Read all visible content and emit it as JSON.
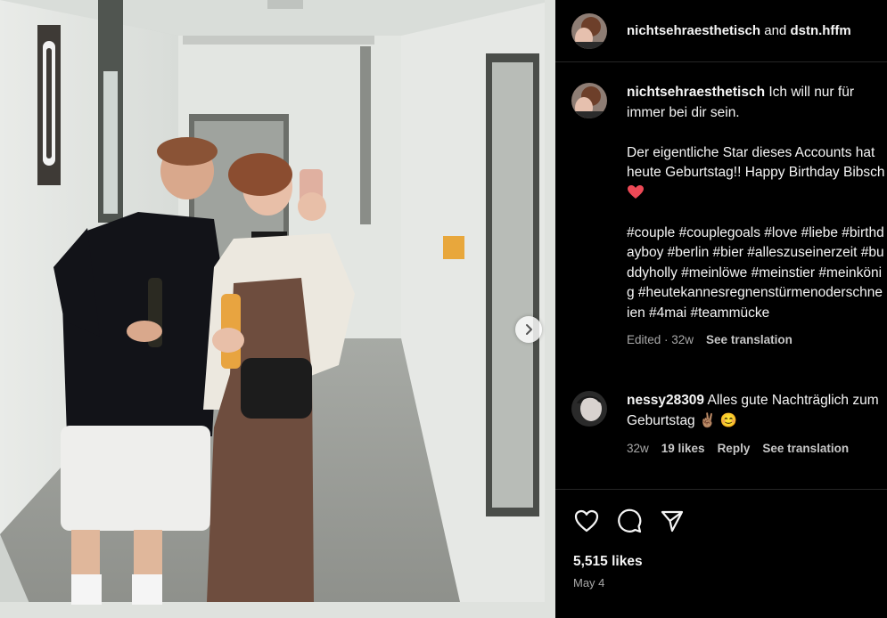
{
  "post": {
    "header": {
      "author": "nichtsehraesthetisch",
      "conjunction": "and",
      "collaborator": "dstn.hffm"
    },
    "caption": {
      "username": "nichtsehraesthetisch",
      "line1": "Ich will nur für immer bei dir sein.",
      "line2": "Der eigentliche Star dieses Accounts hat heute Geburtstag!! Happy Birthday Bibsch",
      "hashtags": "#couple #couplegoals #love #liebe #birthdayboy #berlin #bier #alleszuseinerzeit #buddyholly #meinlöwe #meinstier #meinkönig #heutekannesregnenstürmenoderschneien #4mai #teammücke",
      "edited": "Edited · 32w",
      "see_translation": "See translation"
    },
    "comments": [
      {
        "username": "nessy28309",
        "text": "Alles gute Nachträglich zum Geburtstag ✌🏽 😊",
        "age": "32w",
        "likes": "19 likes",
        "reply": "Reply",
        "see_translation": "See translation"
      }
    ],
    "likes_count": "5,515 likes",
    "date": "May 4"
  },
  "icons": {
    "like": "heart-icon",
    "comment": "comment-bubble-icon",
    "share": "paper-plane-icon",
    "next": "chevron-right-icon"
  },
  "colors": {
    "background": "#000000",
    "text": "#f5f5f5",
    "muted": "#a8a8a8",
    "divider": "#262626",
    "heart": "#ed4956"
  }
}
